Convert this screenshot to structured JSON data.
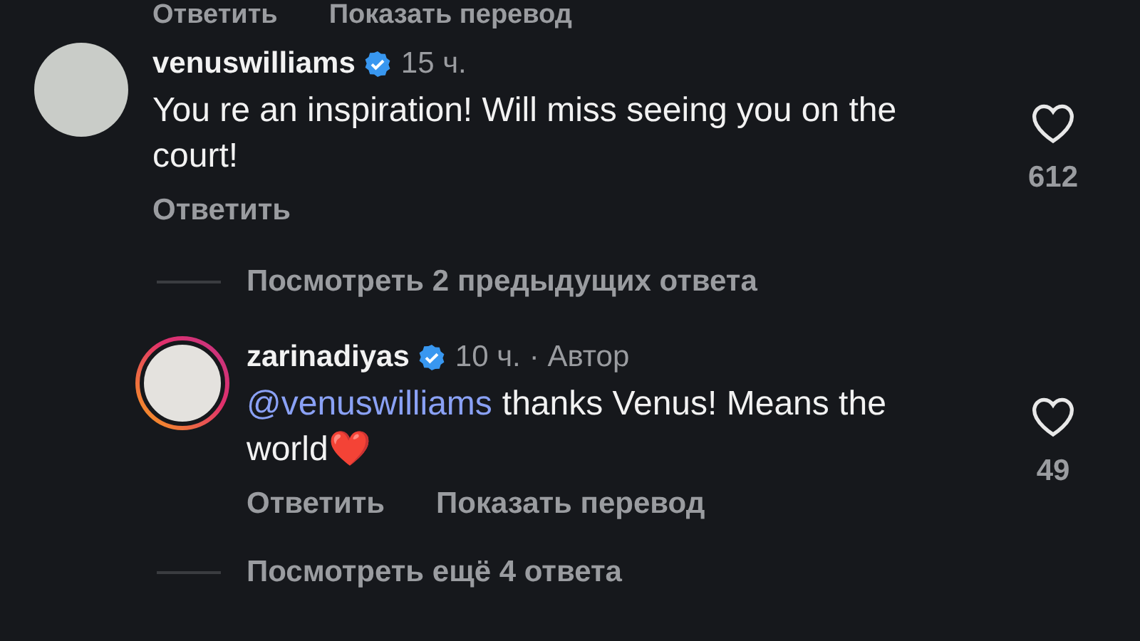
{
  "top_actions": [
    "Ответить",
    "Показать перевод"
  ],
  "comments": [
    {
      "username": "venuswilliams",
      "verified": true,
      "time": "15 ч.",
      "story_ring": false,
      "text": "You re an inspiration! Will miss seeing you on the court!",
      "likes": "612",
      "actions": [
        "Ответить"
      ],
      "replies_link": "Посмотреть 2 предыдущих ответа",
      "reply": false
    },
    {
      "username": "zarinadiyas",
      "verified": true,
      "time": "10 ч.",
      "author_label": "· Автор",
      "story_ring": true,
      "mention": "@venuswilliams",
      "text": "thanks Venus! Means the world",
      "emoji": "❤️",
      "likes": "49",
      "actions": [
        "Ответить",
        "Показать перевод"
      ],
      "replies_link": "Посмотреть ещё 4 ответа",
      "reply": true
    }
  ]
}
